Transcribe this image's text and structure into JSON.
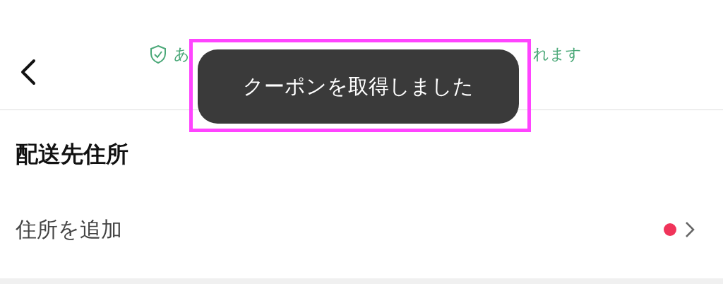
{
  "header": {
    "notice_start": "あ",
    "notice_end": "れます"
  },
  "toast": {
    "message": "クーポンを取得しました",
    "highlighted": true
  },
  "section": {
    "title": "配送先住所"
  },
  "rows": [
    {
      "label": "住所を追加",
      "alert": true
    }
  ]
}
